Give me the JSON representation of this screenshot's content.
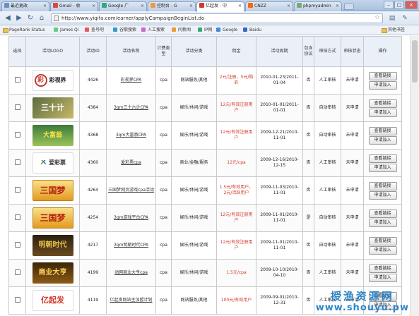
{
  "browser": {
    "tabs": [
      {
        "label": "最近更改"
      },
      {
        "label": "Gmail - 收"
      },
      {
        "label": "Google 广"
      },
      {
        "label": "控制台 - G"
      },
      {
        "label": "亿起发 - 中"
      },
      {
        "label": "CNZZ"
      },
      {
        "label": "phpmyadmin"
      }
    ],
    "active_tab": 4,
    "url": "http://www.yiqifa.com/earner/applyCampaignBeginList.do",
    "bookmarks": [
      "PageRank Status",
      "James Qi",
      "查号吧",
      "谷歌搜索",
      "人工搜索",
      "问新闻",
      "IP网",
      "Google",
      "Baidu"
    ],
    "other_bookmarks": "其他书签"
  },
  "table": {
    "headers": [
      "选择",
      "活动LOGO",
      "活动ID",
      "活动名称",
      "计费类型",
      "活动分类",
      "佣金",
      "活动周期",
      "包含协议",
      "审核方式",
      "审核状态",
      "操作"
    ],
    "rows": [
      {
        "logo_text": "彩视界",
        "logo_sub": "caishijie.com",
        "id": "4426",
        "name": "彩视界CPA",
        "type": "cpa",
        "category": "网站服务/其他",
        "fee": "2元/注册，5元/购彩",
        "period": "2010-01-23/2011-01-04",
        "protocol": "否",
        "audit": "人工审核",
        "status": "未申请"
      },
      {
        "logo_text": "三十计",
        "id": "4384",
        "name": "3gm三十六计CPA",
        "type": "cpa",
        "category": "娱乐/休闲/游戏",
        "fee": "12元/有效注册用户",
        "period": "2010-01-01/2011-01-01",
        "protocol": "否",
        "audit": "自动审核",
        "status": "未申请"
      },
      {
        "logo_text": "大富翁",
        "logo_sub": "3gm.com.cn/dfw",
        "id": "4368",
        "name": "3gm大富翁CPA",
        "type": "cpa",
        "category": "娱乐/休闲/游戏",
        "fee": "12元/有效注册用户",
        "period": "2009-12-21/2010-11-01",
        "protocol": "否",
        "audit": "自动审核",
        "status": "未申请"
      },
      {
        "logo_text": "爱彩票",
        "logo_sub": "www.2caipiao.com",
        "id": "4360",
        "name": "爱彩票cpa",
        "type": "cpa",
        "category": "商业/金融/服务",
        "fee": "12元/cpa",
        "period": "2009-12-16/2010-12-15",
        "protocol": "否",
        "audit": "人工审核",
        "status": "未申请"
      },
      {
        "logo_text": "三国梦",
        "id": "4264",
        "name": "三国梦网页游戏cpa活动",
        "type": "cpa",
        "category": "娱乐/休闲/游戏",
        "fee": "1.5元/有效用户，2元/活跃用户",
        "period": "2009-11-03/2010-11-01",
        "protocol": "否",
        "audit": "人工审核",
        "status": "未申请"
      },
      {
        "logo_text": "三国梦",
        "id": "4254",
        "name": "3gm游戏平台CPA",
        "type": "cpa",
        "category": "娱乐/休闲/游戏",
        "fee": "12元/有效注册用户",
        "period": "2009-11-01/2010-11-01",
        "protocol": "是",
        "audit": "自动审核",
        "status": "未申请"
      },
      {
        "logo_text": "明朝时代",
        "logo_sub": "3gm.com.cn/mcsd",
        "id": "4217",
        "name": "3gm明朝时代CPA",
        "type": "cpa",
        "category": "娱乐/休闲/游戏",
        "fee": "12元/有效注册用户",
        "period": "2009-11-01/2010-11-01",
        "protocol": "否",
        "audit": "自动审核",
        "status": "未申请"
      },
      {
        "logo_text": "商业大亨",
        "id": "4199",
        "name": "动网商业大亨cpa",
        "type": "cpa",
        "category": "娱乐/休闲/游戏",
        "fee": "1.5元/cpa",
        "period": "2009-10-10/2010-04-10",
        "protocol": "否",
        "audit": "人工审核",
        "status": "未申请"
      },
      {
        "logo_text": "亿起发",
        "logo_sub": "YIQIFA.COM",
        "id": "4119",
        "name": "亿起发网站主加盟计划",
        "type": "cpa",
        "category": "网站服务/其他",
        "fee": "100元/有效用户",
        "period": "2009-09-01/2010-12-31",
        "protocol": "否",
        "audit": "人工审核",
        "status": "未申请"
      }
    ],
    "actions": {
      "view": "查看链接",
      "apply": "申请加入"
    }
  },
  "watermark": {
    "line1": "授渔资源网",
    "line2": "www.shouyu.pw"
  }
}
